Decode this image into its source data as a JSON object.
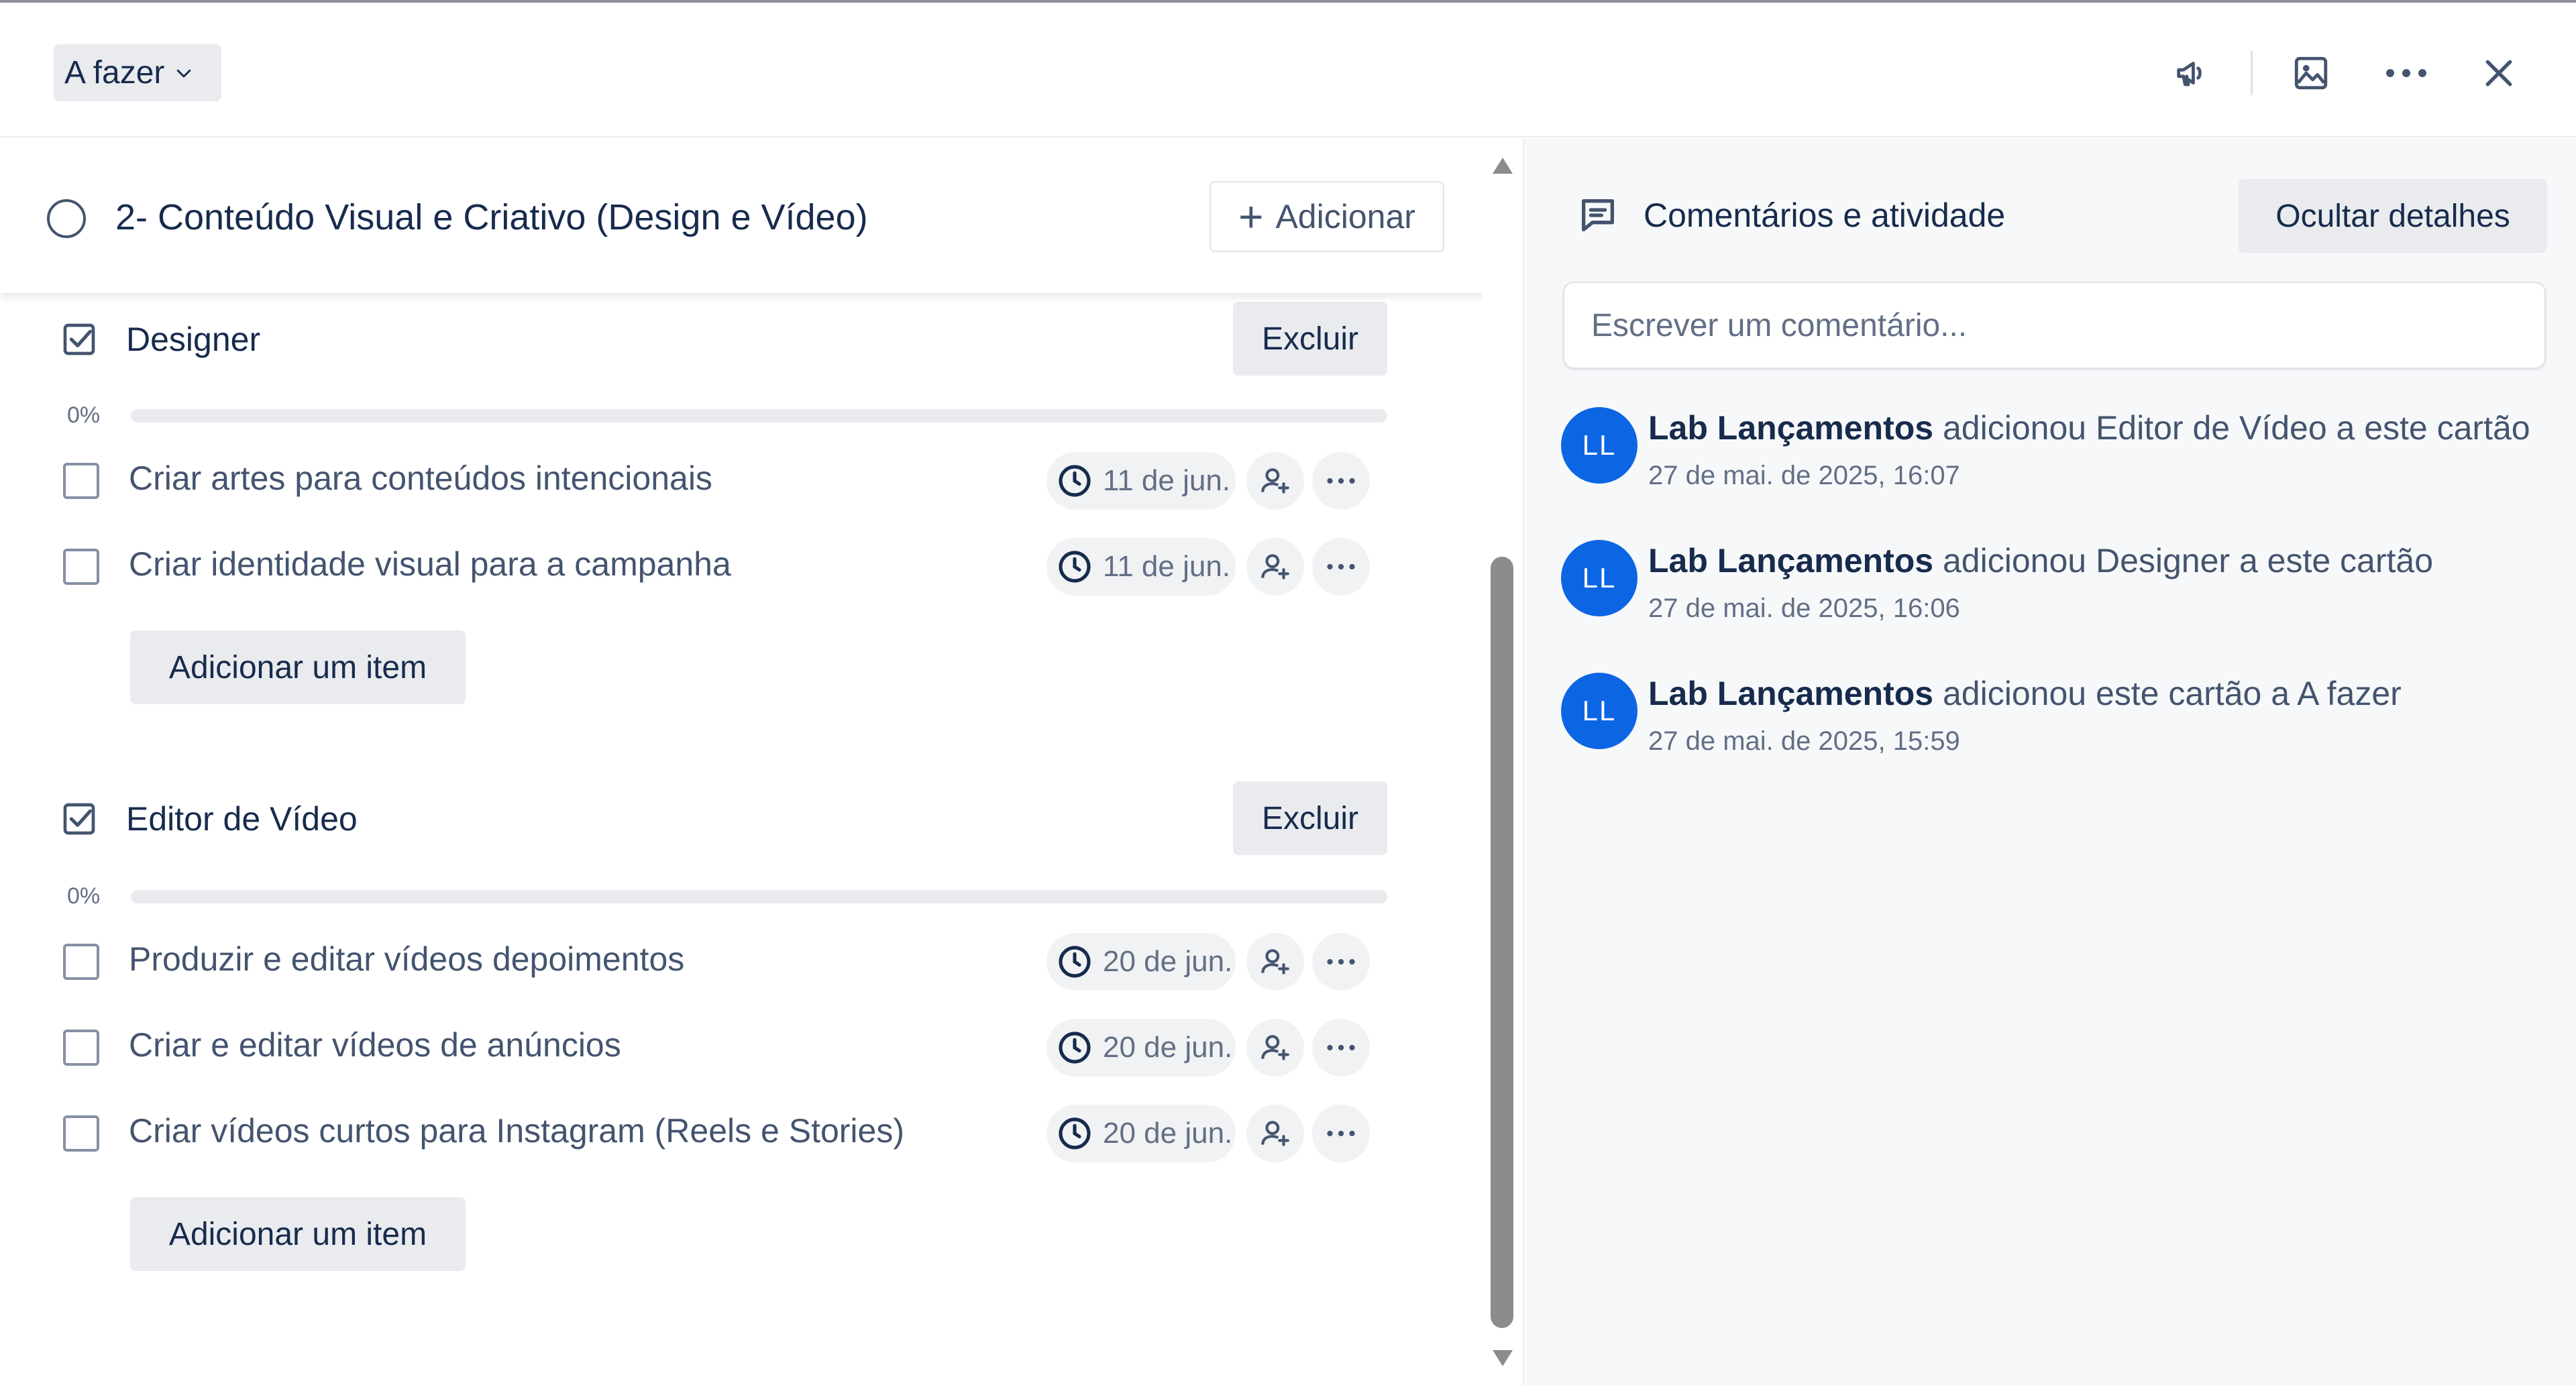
{
  "header": {
    "list_name": "A fazer",
    "icons": [
      "megaphone-icon",
      "image-icon",
      "more-icon",
      "close-icon"
    ]
  },
  "card": {
    "title": "2- Conteúdo Visual e Criativo (Design e Vídeo)",
    "add_label": "Adicionar"
  },
  "checklists": [
    {
      "title": "Designer",
      "delete_label": "Excluir",
      "progress_label": "0%",
      "progress": 0,
      "add_item_label": "Adicionar um item",
      "items": [
        {
          "text": "Criar artes para conteúdos intencionais",
          "due": "11 de jun."
        },
        {
          "text": "Criar identidade visual para a campanha",
          "due": "11 de jun."
        }
      ]
    },
    {
      "title": "Editor de Vídeo",
      "delete_label": "Excluir",
      "progress_label": "0%",
      "progress": 0,
      "add_item_label": "Adicionar um item",
      "items": [
        {
          "text": "Produzir e editar vídeos depoimentos",
          "due": "20 de jun."
        },
        {
          "text": "Criar e editar vídeos de anúncios",
          "due": "20 de jun."
        },
        {
          "text": "Criar vídeos curtos para Instagram (Reels e Stories)",
          "due": "20 de jun."
        }
      ]
    }
  ],
  "sidebar": {
    "title": "Comentários e atividade",
    "hide_label": "Ocultar detalhes",
    "comment_placeholder": "Escrever um comentário...",
    "activity": [
      {
        "initials": "LL",
        "user": "Lab Lançamentos",
        "action": " adicionou Editor de Vídeo a este cartão",
        "time": "27 de mai. de 2025, 16:07"
      },
      {
        "initials": "LL",
        "user": "Lab Lançamentos",
        "action": " adicionou Designer a este cartão",
        "time": "27 de mai. de 2025, 16:06"
      },
      {
        "initials": "LL",
        "user": "Lab Lançamentos",
        "action": " adicionou este cartão a A fazer",
        "time": "27 de mai. de 2025, 15:59"
      }
    ]
  },
  "colors": {
    "accent": "#0c66e4",
    "button_bg": "#e9ebee",
    "text": "#172b4d"
  }
}
